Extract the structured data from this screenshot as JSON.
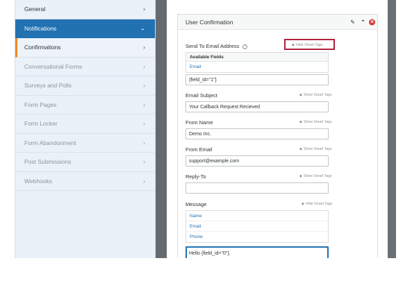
{
  "sidebar": {
    "items": [
      {
        "label": "General",
        "state": "active"
      },
      {
        "label": "Notifications",
        "state": "selected"
      },
      {
        "label": "Confirmations",
        "state": "current"
      },
      {
        "label": "Conversational Forms",
        "state": "disabled"
      },
      {
        "label": "Surveys and Polls",
        "state": "disabled"
      },
      {
        "label": "Form Pages",
        "state": "disabled"
      },
      {
        "label": "Form Locker",
        "state": "disabled"
      },
      {
        "label": "Form Abandonment",
        "state": "disabled"
      },
      {
        "label": "Post Submissions",
        "state": "disabled"
      },
      {
        "label": "Webhooks",
        "state": "disabled"
      }
    ],
    "chevron_right": "›",
    "chevron_down": "⌄"
  },
  "panel": {
    "title": "User Confirmation",
    "icons": {
      "edit": "✎",
      "collapse": "⌃",
      "close": "✕"
    }
  },
  "fields": {
    "send_to": {
      "label": "Send To Email Address",
      "help": "?",
      "smart_tags": "Hide Smart Tags",
      "available_header": "Available Fields",
      "available": [
        "Email"
      ],
      "value": "{field_id=\"1\"}"
    },
    "subject": {
      "label": "Email Subject",
      "smart_tags": "Show Smart Tags",
      "value": "Your Callback Request Recieved"
    },
    "from_name": {
      "label": "From Name",
      "smart_tags": "Show Smart Tags",
      "value": "Demo Inc."
    },
    "from_email": {
      "label": "From Email",
      "smart_tags": "Show Smart Tags",
      "value": "support@example.com"
    },
    "reply_to": {
      "label": "Reply-To",
      "smart_tags": "Show Smart Tags",
      "value": ""
    },
    "message": {
      "label": "Message",
      "smart_tags": "Hide Smart Tags",
      "available": [
        "Name",
        "Email",
        "Phone"
      ],
      "value": "Hello {field_id=\"0\"},"
    }
  },
  "colors": {
    "accent": "#2271b1",
    "highlight": "#b0203a",
    "sidebar_bg": "#eaf1f9",
    "close": "#d63638"
  },
  "tag_glyph": "◆"
}
